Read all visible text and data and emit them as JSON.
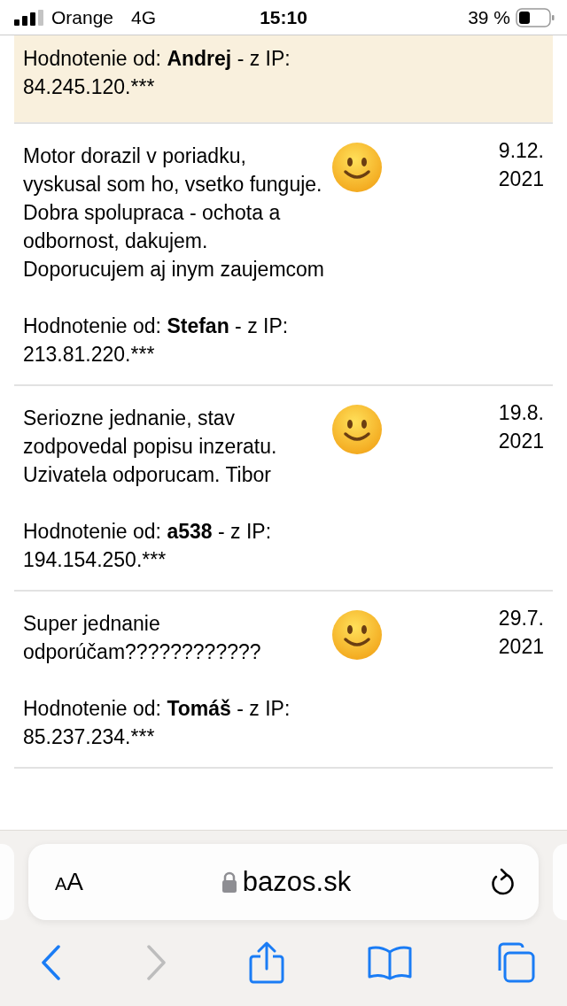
{
  "status_bar": {
    "carrier": "Orange",
    "network": "4G",
    "time": "15:10",
    "battery": "39 %"
  },
  "reviews": [
    {
      "highlighted": true,
      "author_line": "Hodnotenie od: **Andrej** - z IP: 84.245.120.***"
    },
    {
      "highlighted": false,
      "text": "Motor dorazil v poriadku, vyskusal som ho, vsetko funguje. Dobra spolupraca - ochota a odbornost, dakujem. Doporucujem aj inym zaujemcom",
      "author_line": "Hodnotenie od: **Stefan** - z IP: 213.81.220.***",
      "date": "9.12. 2021"
    },
    {
      "highlighted": false,
      "text": "Seriozne jednanie, stav zodpovedal popisu inzeratu. Uzivatela odporucam. Tibor",
      "author_line": "Hodnotenie od: **a538** - z IP: 194.154.250.***",
      "date": "19.8. 2021"
    },
    {
      "highlighted": false,
      "text": "Super jednanie odporúčam????????????",
      "author_line": "Hodnotenie od: **Tomáš** - z IP: 85.237.234.***",
      "date": "29.7. 2021"
    }
  ],
  "browser": {
    "text_size": "AA",
    "address": "bazos.sk"
  }
}
